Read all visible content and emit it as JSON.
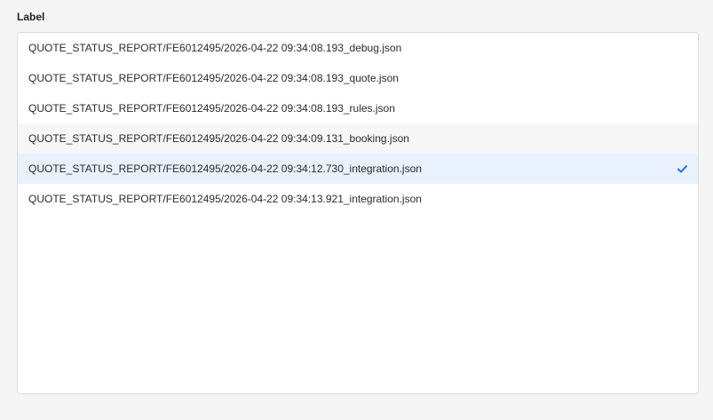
{
  "field": {
    "label": "Label"
  },
  "listbox": {
    "options": [
      {
        "label": "QUOTE_STATUS_REPORT/FE6012495/2026-04-22 09:34:08.193_debug.json",
        "selected": false
      },
      {
        "label": "QUOTE_STATUS_REPORT/FE6012495/2026-04-22 09:34:08.193_quote.json",
        "selected": false
      },
      {
        "label": "QUOTE_STATUS_REPORT/FE6012495/2026-04-22 09:34:08.193_rules.json",
        "selected": false
      },
      {
        "label": "QUOTE_STATUS_REPORT/FE6012495/2026-04-22 09:34:09.131_booking.json",
        "selected": false
      },
      {
        "label": "QUOTE_STATUS_REPORT/FE6012495/2026-04-22 09:34:12.730_integration.json",
        "selected": true
      },
      {
        "label": "QUOTE_STATUS_REPORT/FE6012495/2026-04-22 09:34:13.921_integration.json",
        "selected": false
      }
    ],
    "selected_icon": "checkmark-icon"
  },
  "colors": {
    "accent": "#2f6fd6",
    "selected_bg": "#e9f1fd",
    "hover_bg": "#f7f7f7"
  }
}
